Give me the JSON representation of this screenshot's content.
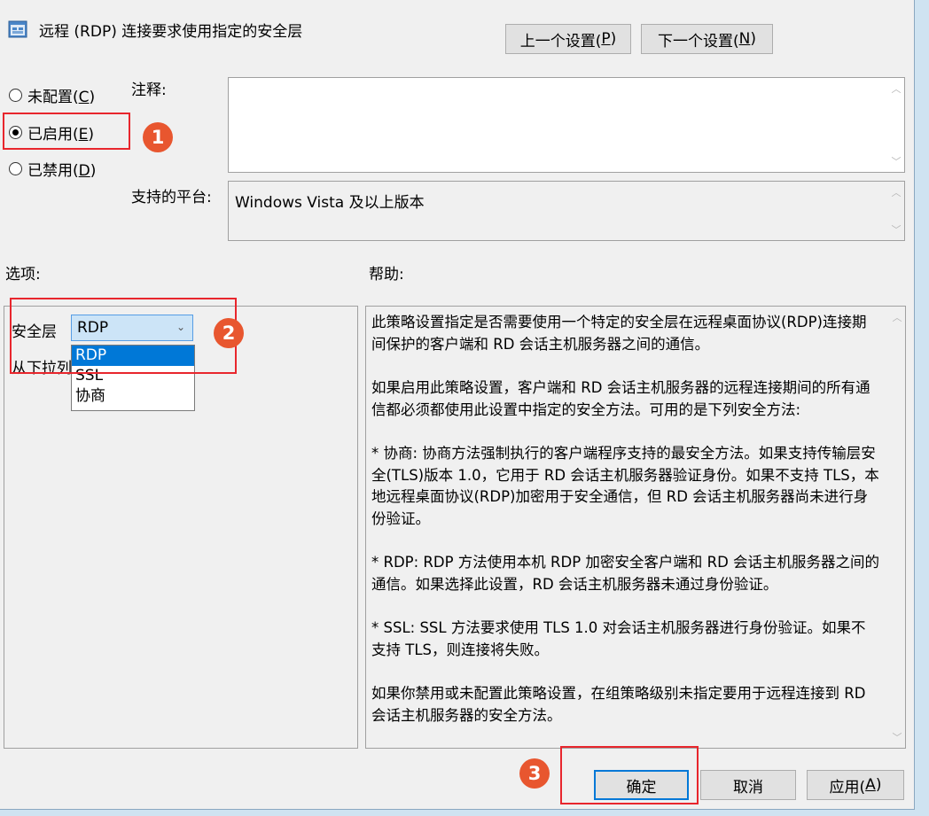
{
  "title": "远程 (RDP) 连接要求使用指定的安全层",
  "nav": {
    "prev": "上一个设置(",
    "prev_key": "P",
    "next": "下一个设置(",
    "next_key": "N",
    "close": ")"
  },
  "radios": [
    {
      "label": "未配置(",
      "key": "C",
      "checked": false
    },
    {
      "label": "已启用(",
      "key": "E",
      "checked": true
    },
    {
      "label": "已禁用(",
      "key": "D",
      "checked": false
    }
  ],
  "comment_label": "注释:",
  "comment_value": "",
  "platform_label": "支持的平台:",
  "platform_value": "Windows Vista 及以上版本",
  "options_label": "选项:",
  "help_label": "帮助:",
  "options": {
    "layer_label": "安全层",
    "combo_value": "RDP",
    "hint_text": "从下拉列表中选择安全层",
    "dropdown_items": [
      "RDP",
      "SSL",
      "协商"
    ],
    "selected_index": 0
  },
  "help_paragraphs": [
    "此策略设置指定是否需要使用一个特定的安全层在远程桌面协议(RDP)连接期间保护的客户端和 RD 会话主机服务器之间的通信。",
    "如果启用此策略设置，客户端和 RD 会话主机服务器的远程连接期间的所有通信都必须都使用此设置中指定的安全方法。可用的是下列安全方法:",
    " * 协商: 协商方法强制执行的客户端程序支持的最安全方法。如果支持传输层安全(TLS)版本 1.0，它用于 RD 会话主机服务器验证身份。如果不支持 TLS，本地远程桌面协议(RDP)加密用于安全通信，但 RD 会话主机服务器尚未进行身份验证。",
    " * RDP: RDP 方法使用本机 RDP 加密安全客户端和 RD 会话主机服务器之间的通信。如果选择此设置，RD 会话主机服务器未通过身份验证。",
    " * SSL: SSL 方法要求使用 TLS 1.0 对会话主机服务器进行身份验证。如果不支持 TLS，则连接将失败。",
    "如果你禁用或未配置此策略设置，在组策略级别未指定要用于远程连接到 RD 会话主机服务器的安全方法。"
  ],
  "buttons": {
    "ok": "确定",
    "cancel": "取消",
    "apply": "应用(",
    "apply_key": "A"
  },
  "badges": [
    "1",
    "2",
    "3"
  ],
  "colors": {
    "annotation_red": "#e8262d",
    "badge": "#e8562f",
    "selection": "#0078d7"
  }
}
